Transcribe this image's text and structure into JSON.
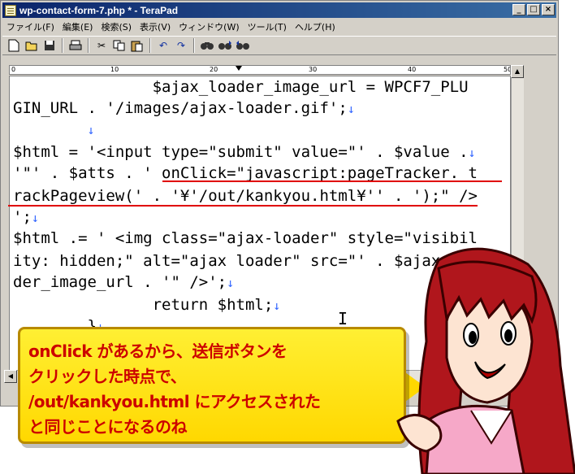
{
  "window": {
    "title": "wp-contact-form-7.php * - TeraPad"
  },
  "window_buttons": {
    "minimize": "_",
    "maximize": "□",
    "close": "×"
  },
  "menu": [
    "ファイル(F)",
    "編集(E)",
    "検索(S)",
    "表示(V)",
    "ウィンドウ(W)",
    "ツール(T)",
    "ヘルプ(H)"
  ],
  "toolbar": {
    "icons": [
      "new-file-icon",
      "open-folder-icon",
      "save-icon",
      "print-icon",
      "cut-icon",
      "copy-icon",
      "paste-icon",
      "undo-icon",
      "redo-icon",
      "find-icon",
      "find-next-icon",
      "find-prev-icon"
    ]
  },
  "ruler": {
    "labels": [
      "0",
      "10",
      "20",
      "30",
      "40",
      "50"
    ]
  },
  "editor": {
    "return_mark": "↓",
    "lines": [
      "               $ajax_loader_image_url = WPCF7_PLU",
      "GIN_URL . '/images/ajax-loader.gif';",
      "        ",
      "$html = '<input type=\"submit\" value=\"' . $value .",
      "'\"' . $atts . ' onClick=\"javascript:pageTracker._t",
      "rackPageview(' . '¥'/out/kankyou.html¥'' . ');\" />",
      "';",
      "$html .= ' <img class=\"ajax-loader\" style=\"visibil",
      "ity: hidden;\" alt=\"ajax loader\" src=\"' . $ajax_loa",
      "der_image_url . '\" />';",
      "               return $html;",
      "        }"
    ]
  },
  "callout": {
    "lines": [
      "onClick があるから、送信ボタンを",
      "クリックした時点で、",
      "/out/kankyou.html にアクセスされた",
      "と同じことになるのね"
    ]
  },
  "colors": {
    "titlebar": "#0a246a",
    "underline": "#e00000",
    "callout_bg": "#ffe600",
    "callout_text": "#cc0000",
    "hair": "#b0161c",
    "kimono": "#f6a8c8"
  }
}
